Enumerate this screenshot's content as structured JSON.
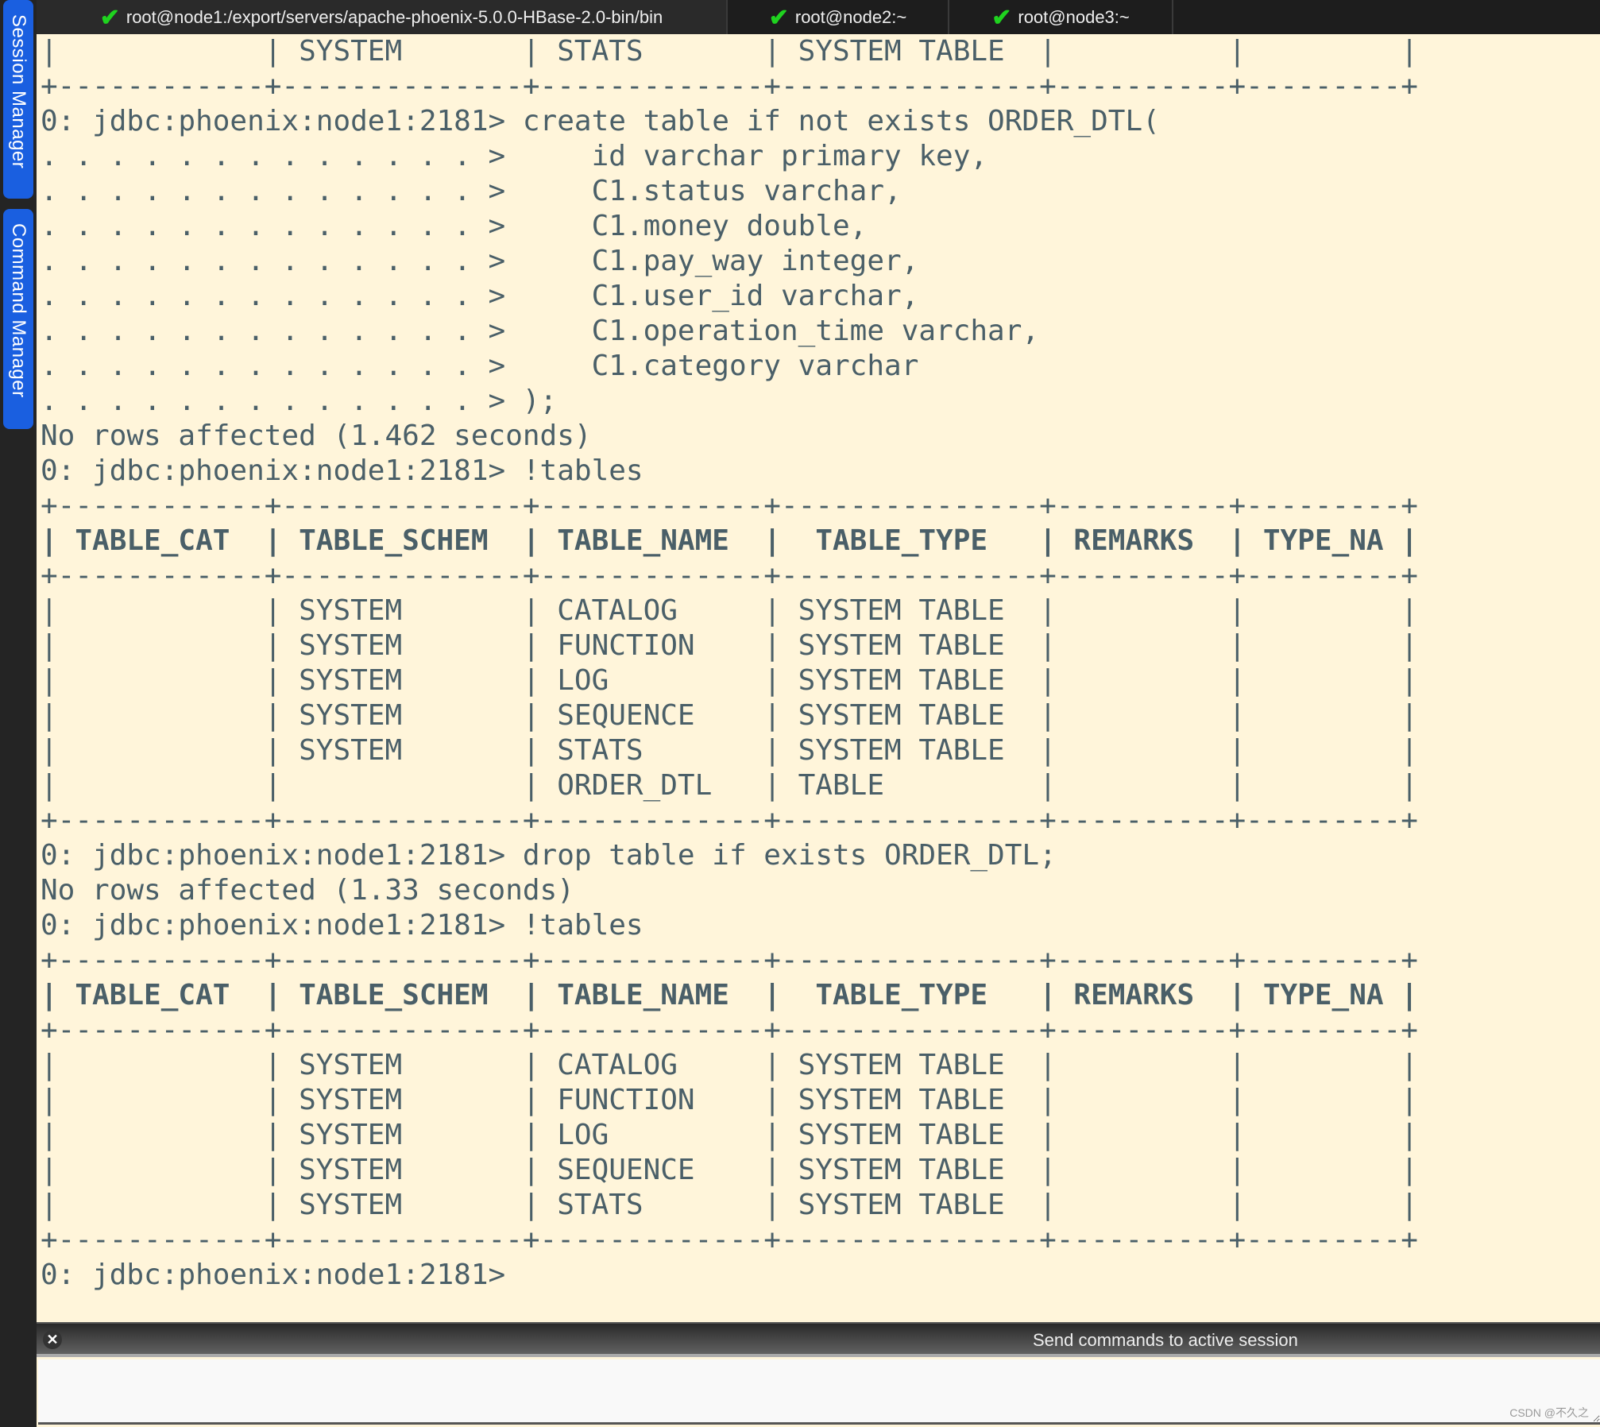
{
  "sidebar": {
    "session_manager": "Session Manager",
    "command_manager": "Command Manager"
  },
  "tabs": [
    {
      "label": "root@node1:/export/servers/apache-phoenix-5.0.0-HBase-2.0-bin/bin",
      "status_icon": "check-icon"
    },
    {
      "label": "root@node2:~",
      "status_icon": "check-icon"
    },
    {
      "label": "root@node3:~",
      "status_icon": "check-icon"
    }
  ],
  "colors": {
    "terminal_bg": "#fff5da",
    "terminal_text": "#4a5f68",
    "check": "#1fd31f",
    "sidebar_tab": "#1a5fe0"
  },
  "terminal": {
    "lines": [
      {
        "text": "|            | SYSTEM       | STATS       | SYSTEM TABLE  |          |         |",
        "bold": false
      },
      {
        "text": "+------------+--------------+-------------+---------------+----------+---------+",
        "bold": false
      },
      {
        "text": "0: jdbc:phoenix:node1:2181> create table if not exists ORDER_DTL(",
        "bold": false
      },
      {
        "text": ". . . . . . . . . . . . . >     id varchar primary key,",
        "bold": false
      },
      {
        "text": ". . . . . . . . . . . . . >     C1.status varchar,",
        "bold": false
      },
      {
        "text": ". . . . . . . . . . . . . >     C1.money double,",
        "bold": false
      },
      {
        "text": ". . . . . . . . . . . . . >     C1.pay_way integer,",
        "bold": false
      },
      {
        "text": ". . . . . . . . . . . . . >     C1.user_id varchar,",
        "bold": false
      },
      {
        "text": ". . . . . . . . . . . . . >     C1.operation_time varchar,",
        "bold": false
      },
      {
        "text": ". . . . . . . . . . . . . >     C1.category varchar",
        "bold": false
      },
      {
        "text": ". . . . . . . . . . . . . > );",
        "bold": false
      },
      {
        "text": "No rows affected (1.462 seconds)",
        "bold": false
      },
      {
        "text": "0: jdbc:phoenix:node1:2181> !tables",
        "bold": false
      },
      {
        "text": "+------------+--------------+-------------+---------------+----------+---------+",
        "bold": false
      },
      {
        "text": "| TABLE_CAT  | TABLE_SCHEM  | TABLE_NAME  |  TABLE_TYPE   | REMARKS  | TYPE_NA |",
        "bold": true
      },
      {
        "text": "+------------+--------------+-------------+---------------+----------+---------+",
        "bold": false
      },
      {
        "text": "|            | SYSTEM       | CATALOG     | SYSTEM TABLE  |          |         |",
        "bold": false
      },
      {
        "text": "|            | SYSTEM       | FUNCTION    | SYSTEM TABLE  |          |         |",
        "bold": false
      },
      {
        "text": "|            | SYSTEM       | LOG         | SYSTEM TABLE  |          |         |",
        "bold": false
      },
      {
        "text": "|            | SYSTEM       | SEQUENCE    | SYSTEM TABLE  |          |         |",
        "bold": false
      },
      {
        "text": "|            | SYSTEM       | STATS       | SYSTEM TABLE  |          |         |",
        "bold": false
      },
      {
        "text": "|            |              | ORDER_DTL   | TABLE         |          |         |",
        "bold": false
      },
      {
        "text": "+------------+--------------+-------------+---------------+----------+---------+",
        "bold": false
      },
      {
        "text": "0: jdbc:phoenix:node1:2181> drop table if exists ORDER_DTL;",
        "bold": false
      },
      {
        "text": "No rows affected (1.33 seconds)",
        "bold": false
      },
      {
        "text": "0: jdbc:phoenix:node1:2181> !tables",
        "bold": false
      },
      {
        "text": "+------------+--------------+-------------+---------------+----------+---------+",
        "bold": false
      },
      {
        "text": "| TABLE_CAT  | TABLE_SCHEM  | TABLE_NAME  |  TABLE_TYPE   | REMARKS  | TYPE_NA |",
        "bold": true
      },
      {
        "text": "+------------+--------------+-------------+---------------+----------+---------+",
        "bold": false
      },
      {
        "text": "|            | SYSTEM       | CATALOG     | SYSTEM TABLE  |          |         |",
        "bold": false
      },
      {
        "text": "|            | SYSTEM       | FUNCTION    | SYSTEM TABLE  |          |         |",
        "bold": false
      },
      {
        "text": "|            | SYSTEM       | LOG         | SYSTEM TABLE  |          |         |",
        "bold": false
      },
      {
        "text": "|            | SYSTEM       | SEQUENCE    | SYSTEM TABLE  |          |         |",
        "bold": false
      },
      {
        "text": "|            | SYSTEM       | STATS       | SYSTEM TABLE  |          |         |",
        "bold": false
      },
      {
        "text": "+------------+--------------+-------------+---------------+----------+---------+",
        "bold": false
      },
      {
        "text": "0: jdbc:phoenix:node1:2181> ",
        "bold": false
      }
    ]
  },
  "command_bar": {
    "close_icon": "close-icon",
    "label": "Send commands to active session",
    "input_value": ""
  },
  "watermark": "CSDN @不久之"
}
